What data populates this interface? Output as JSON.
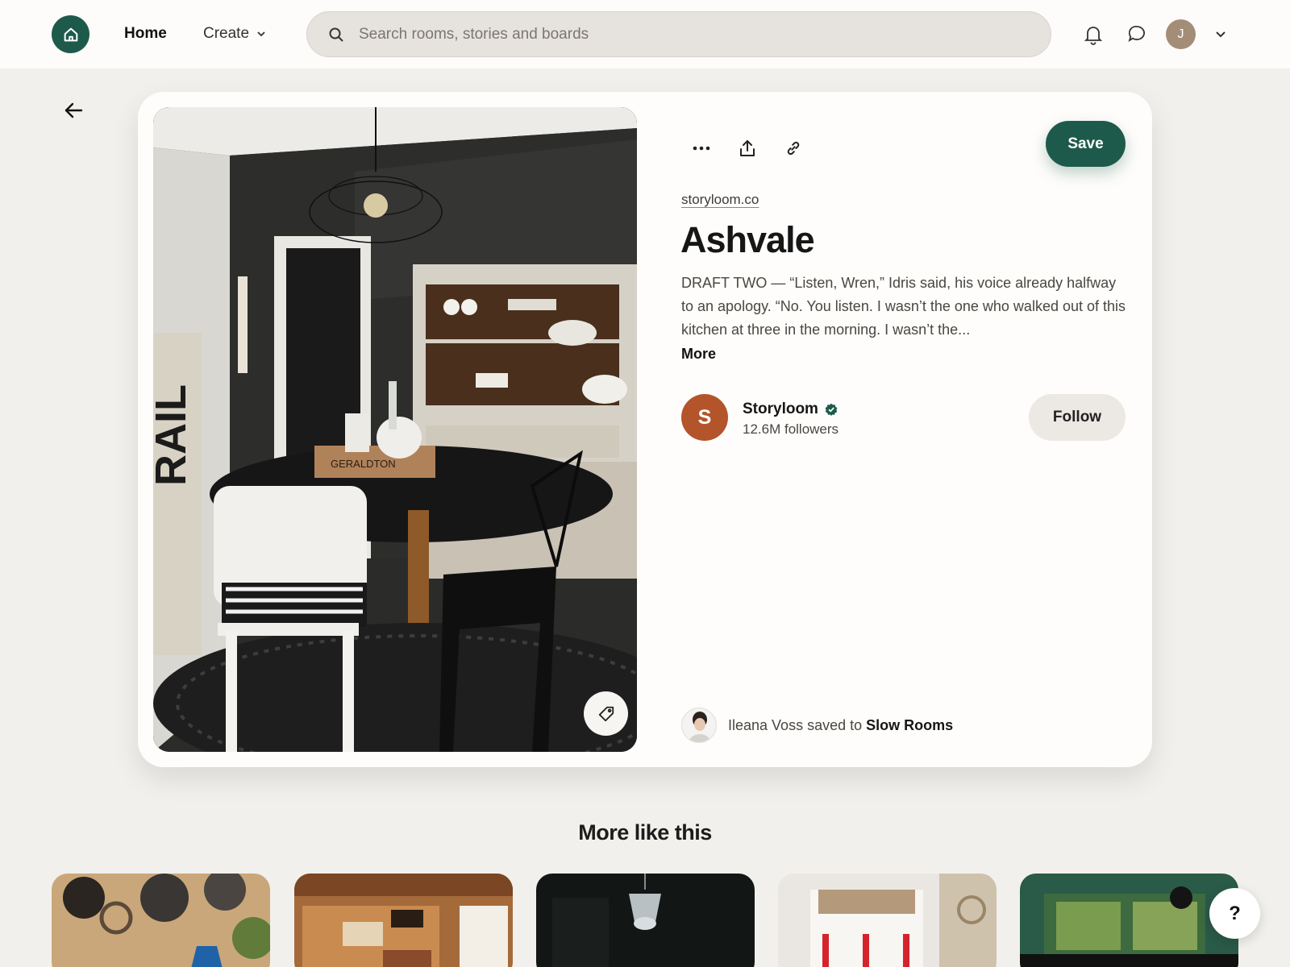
{
  "header": {
    "nav_home": "Home",
    "nav_create": "Create",
    "search_placeholder": "Search rooms, stories and boards",
    "avatar_initial": "J"
  },
  "pin": {
    "source": "storyloom.co",
    "title": "Ashvale",
    "description": "DRAFT TWO — “Listen, Wren,” Idris said, his voice already halfway to an apology. “No. You listen. I wasn’t the one who walked out of this kitchen at three in the morning. I wasn’t the...",
    "more_label": "More",
    "save_label": "Save",
    "image_text": "GERALDTON"
  },
  "author": {
    "initial": "S",
    "name": "Storyloom",
    "followers": "12.6M followers",
    "follow_label": "Follow",
    "verified": true
  },
  "saved": {
    "user": "Ileana Voss",
    "connector": "saved to",
    "board": "Slow Rooms"
  },
  "more_like_this": {
    "title": "More like this",
    "thumbnails": [
      "kitchen-utensils",
      "wood-cabin-kitchen",
      "dark-chandelier-room",
      "white-bright-room",
      "green-tiled-kitchen"
    ]
  },
  "help_label": "?",
  "colors": {
    "brand": "#1e5a4b",
    "page_bg": "#f2f0ed",
    "author_avatar": "#b4542b"
  },
  "icons": [
    "home-icon",
    "chevron-down-icon",
    "search-icon",
    "bell-icon",
    "chat-icon",
    "back-arrow-icon",
    "more-icon",
    "share-icon",
    "link-icon",
    "tag-icon",
    "verified-icon"
  ]
}
